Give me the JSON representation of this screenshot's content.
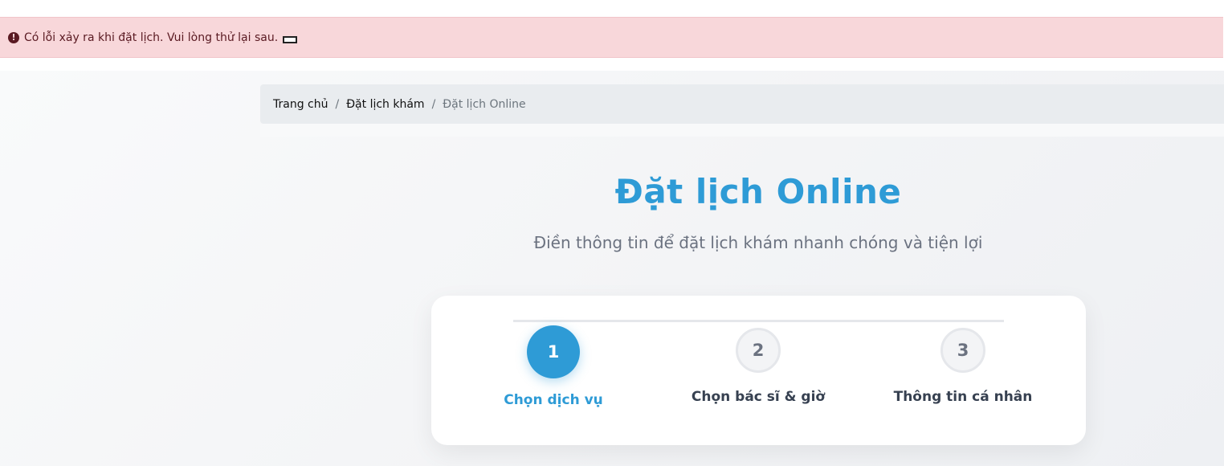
{
  "alert": {
    "icon": "exclamation-circle-icon",
    "message": "Có lỗi xảy ra khi đặt lịch. Vui lòng thử lại sau."
  },
  "breadcrumb": {
    "items": [
      {
        "label": "Trang chủ"
      },
      {
        "label": "Đặt lịch khám"
      }
    ],
    "separator": "/",
    "active": "Đặt lịch Online"
  },
  "header": {
    "title": "Đặt lịch Online",
    "subtitle": "Điền thông tin để đặt lịch khám nhanh chóng và tiện lợi"
  },
  "steps": [
    {
      "number": "1",
      "label": "Chọn dịch vụ",
      "active": true
    },
    {
      "number": "2",
      "label": "Chọn bác sĩ & giờ",
      "active": false
    },
    {
      "number": "3",
      "label": "Thông tin cá nhân",
      "active": false
    }
  ],
  "colors": {
    "accent": "#2e9bd6",
    "alert_bg": "#f8d7da",
    "alert_text": "#5a1a22"
  }
}
